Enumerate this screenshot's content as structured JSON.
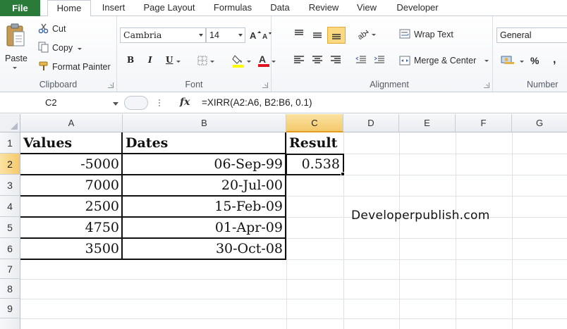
{
  "tabs": [
    "File",
    "Home",
    "Insert",
    "Page Layout",
    "Formulas",
    "Data",
    "Review",
    "View",
    "Developer"
  ],
  "clipboard": {
    "paste": "Paste",
    "cut": "Cut",
    "copy": "Copy",
    "format_painter": "Format Painter",
    "label": "Clipboard"
  },
  "font": {
    "name": "Cambria",
    "size": "14",
    "bold": "B",
    "italic": "I",
    "underline": "U",
    "label": "Font",
    "highlight_color": "#ffff00",
    "font_color": "#e0141e"
  },
  "alignment": {
    "wrap_text": "Wrap Text",
    "merge_center": "Merge & Center",
    "label": "Alignment"
  },
  "number": {
    "format": "General",
    "percent": "%",
    "comma": ",",
    "label": "Number"
  },
  "formula_bar": {
    "name_box": "C2",
    "fx": "fx",
    "formula": "=XIRR(A2:A6, B2:B6, 0.1)"
  },
  "columns": [
    "A",
    "B",
    "C",
    "D",
    "E",
    "F",
    "G"
  ],
  "rows": [
    "1",
    "2",
    "3",
    "4",
    "5",
    "6",
    "7",
    "8",
    "9"
  ],
  "headers": {
    "a": "Values",
    "b": "Dates",
    "c": "Result"
  },
  "table": [
    {
      "value": "-5000",
      "date": "06-Sep-99"
    },
    {
      "value": "7000",
      "date": "20-Jul-00"
    },
    {
      "value": "2500",
      "date": "15-Feb-09"
    },
    {
      "value": "4750",
      "date": "01-Apr-09"
    },
    {
      "value": "3500",
      "date": "30-Oct-08"
    }
  ],
  "result": "0.538",
  "watermark": "Developerpublish.com",
  "colors": {
    "file_tab": "#2a7a3a",
    "selected_header": "#f4c96c"
  }
}
